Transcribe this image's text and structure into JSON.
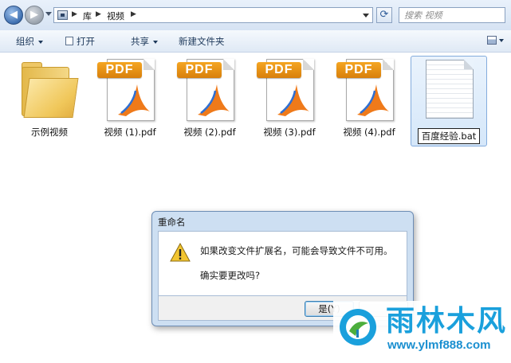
{
  "addressbar": {
    "breadcrumb": [
      "库",
      "视频"
    ],
    "search_placeholder": "搜索 视频"
  },
  "toolbar": {
    "organize": "组织",
    "open": "打开",
    "share": "共享",
    "new_folder": "新建文件夹"
  },
  "files": [
    {
      "name": "示例视频",
      "type": "folder"
    },
    {
      "name": "视频 (1).pdf",
      "type": "pdf"
    },
    {
      "name": "视频 (2).pdf",
      "type": "pdf"
    },
    {
      "name": "视频 (3).pdf",
      "type": "pdf"
    },
    {
      "name": "视频 (4).pdf",
      "type": "pdf"
    },
    {
      "name": "百度经验.bat",
      "type": "bat",
      "state": "renaming"
    }
  ],
  "pdf_badge": "PDF",
  "dialog": {
    "title": "重命名",
    "message": "如果改变文件扩展名，可能会导致文件不可用。",
    "question": "确实要更改吗?",
    "yes": "是(Y)",
    "no": ""
  },
  "watermark": {
    "brand": "雨林木风",
    "url": "www.ylmf888.com"
  },
  "colors": {
    "accent": "#1aa0dc",
    "pdf_badge": "#f5a623",
    "selection": "#d5e7fa"
  }
}
